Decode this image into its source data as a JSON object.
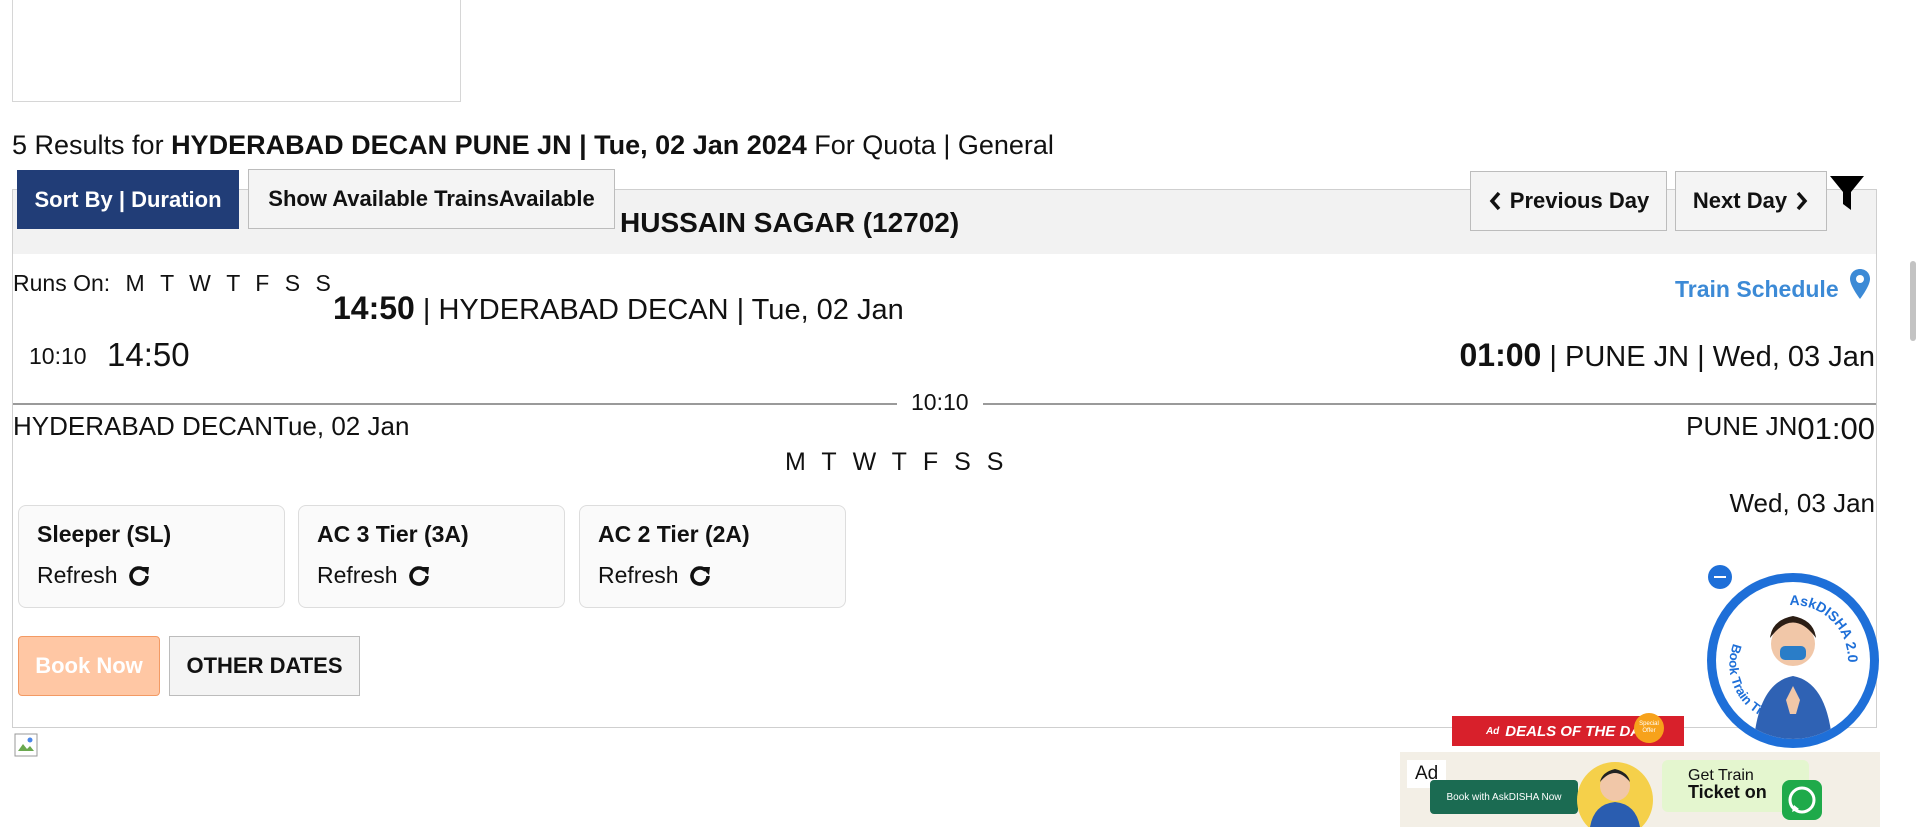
{
  "results": {
    "count_prefix": "5 Results for ",
    "route": "HYDERABAD DECAN PUNE JN | Tue, 02 Jan 2024",
    "quota": " For Quota | General"
  },
  "toolbar": {
    "sort_label": "Sort By | Duration",
    "available_label": "Show Available TrainsAvailable",
    "prev_label": "Previous Day",
    "next_label": "Next Day"
  },
  "train": {
    "name": "HUSSAIN SAGAR (12702)",
    "runs_on_label": "Runs On:",
    "run_days": [
      "M",
      "T",
      "W",
      "T",
      "F",
      "S",
      "S"
    ],
    "schedule_label": "Train Schedule",
    "departure_time": "14:50",
    "departure_text": " | HYDERABAD DECAN | Tue, 02 Jan",
    "duration": "10:10",
    "departure_time_mid": "14:50",
    "arrival_time": "01:00",
    "arrival_text": " | PUNE JN | Wed, 03 Jan",
    "from_line": "HYDERABAD DECANTue, 02 Jan",
    "to_station": "PUNE JN",
    "to_time": "01:00",
    "arrival_date": "Wed, 03 Jan"
  },
  "classes": [
    {
      "name": "Sleeper (SL)",
      "refresh": "Refresh"
    },
    {
      "name": "AC 3 Tier (3A)",
      "refresh": "Refresh"
    },
    {
      "name": "AC 2 Tier (2A)",
      "refresh": "Refresh"
    }
  ],
  "actions": {
    "book_now": "Book Now",
    "other_dates": "OTHER DATES"
  },
  "ad": {
    "deals": "DEALS OF THE DAY",
    "deals_prefix": "Ad",
    "tag": "Ad",
    "special": "Special Offer",
    "book_with": "Book with AskDISHA Now",
    "get_train": "Get Train",
    "ticket_on": "Ticket on"
  },
  "disha": {
    "title": "AskDISHA 2.0",
    "subtitle": "Book Train Ticket"
  },
  "colors": {
    "sort_bg": "#213d77",
    "schedule_link": "#3c8ad6",
    "book_now_bg": "#ffc7a4",
    "disha_blue": "#1e6fd8",
    "deals_red": "#d8202b"
  }
}
